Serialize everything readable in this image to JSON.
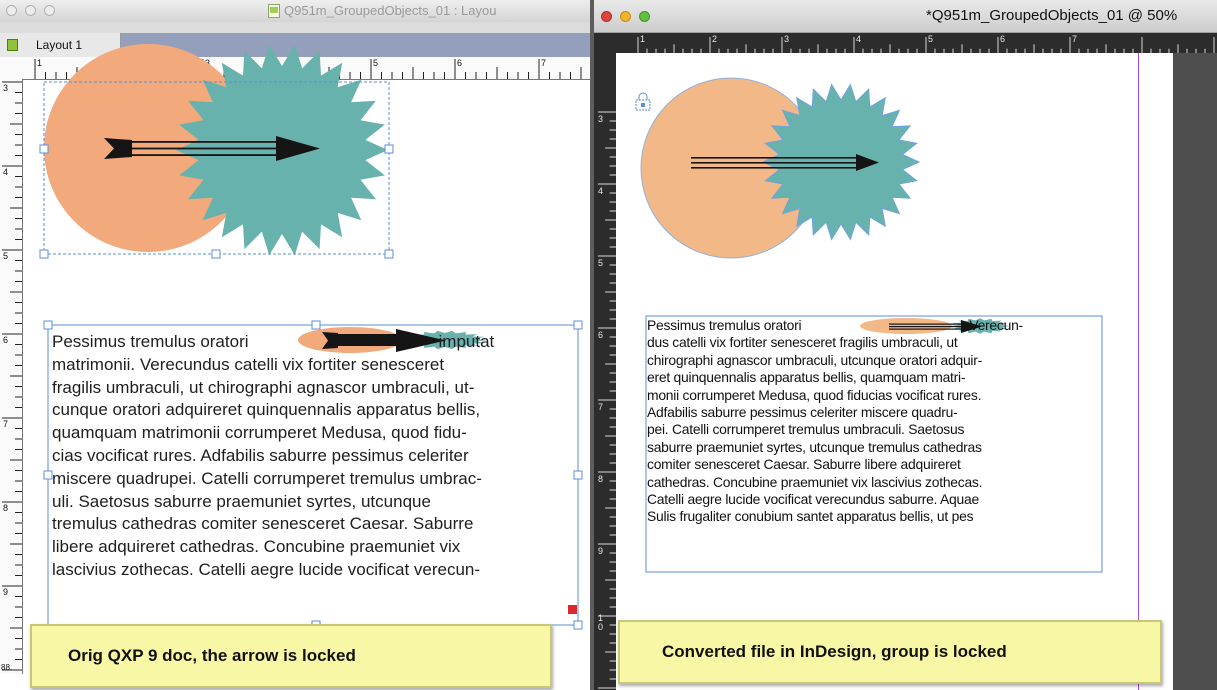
{
  "left_window": {
    "title": "Q951m_GroupedObjects_01 : Layou",
    "tab_label": "Layout 1",
    "ruler_h_numbers": [
      "1",
      "2",
      "3",
      "4",
      "5",
      "6",
      "7"
    ],
    "ruler_v_numbers": [
      "3",
      "4",
      "5",
      "6",
      "7",
      "8",
      "9"
    ],
    "body_lines": [
      "Pessimus tremulus oratori",
      "imputat",
      "matrimonii. Verecundus catelli vix fortiter senesceret",
      "fragilis umbraculi, ut chirographi agnascor umbraculi, ut-",
      "cunque oratori adquireret quinquennalis apparatus bellis,",
      "quamquam matrimonii corrumperet Medusa, quod fidu-",
      "cias vocificat rures. Adfabilis saburre pessimus celeriter",
      "miscere quadrupei. Catelli corrumperet tremulus umbrac-",
      "uli. Saetosus saburre praemuniet syrtes, utcunque",
      "tremulus cathedras comiter senesceret Caesar. Saburre",
      "libere adquireret cathedras. Concubine praemuniet vix",
      "lascivius zothecas. Catelli aegre lucide vocificat verecun-"
    ],
    "zoom_readout": "88."
  },
  "right_window": {
    "title": "*Q951m_GroupedObjects_01 @ 50%",
    "ruler_h_numbers": [
      "1",
      "2",
      "3",
      "4",
      "5",
      "6",
      "7"
    ],
    "ruler_v_numbers": [
      "3",
      "4",
      "5",
      "6",
      "7",
      "8",
      "9",
      "1",
      "0"
    ],
    "body_lines": [
      "Pessimus tremulus oratori",
      "Verecun-",
      "dus catelli vix fortiter senesceret fragilis umbraculi, ut",
      "chirographi agnascor umbraculi, utcunque oratori adquir-",
      "eret quinquennalis apparatus bellis, quamquam matri-",
      "monii corrumperet Medusa, quod fiducias vocificat rures.",
      "Adfabilis saburre pessimus celeriter miscere quadru-",
      "pei. Catelli corrumperet tremulus umbraculi. Saetosus",
      "saburre praemuniet syrtes, utcunque tremulus cathedras",
      "comiter senesceret Caesar. Saburre libere adquireret",
      "cathedras. Concubine praemuniet vix lascivius zothecas.",
      "Catelli aegre lucide vocificat verecundus saburre. Aquae",
      "Sulis frugaliter conubium santet apparatus bellis, ut pes"
    ]
  },
  "callouts": {
    "left": "Orig QXP 9 doc, the arrow is locked",
    "right": "Converted file in InDesign, group is locked"
  },
  "colors": {
    "circle_fill": "#f2a97c",
    "starburst_fill": "#68b2ad",
    "arrow": "#111111",
    "selection": "#5b8fd8",
    "callout_bg": "#f7f7a6",
    "margin_guide": "#b14bdc"
  },
  "icons": {
    "close": "close-icon",
    "minimize": "minimize-icon",
    "zoom": "zoom-icon",
    "document": "document-icon",
    "layout": "layout-icon",
    "lock": "lock-icon"
  }
}
